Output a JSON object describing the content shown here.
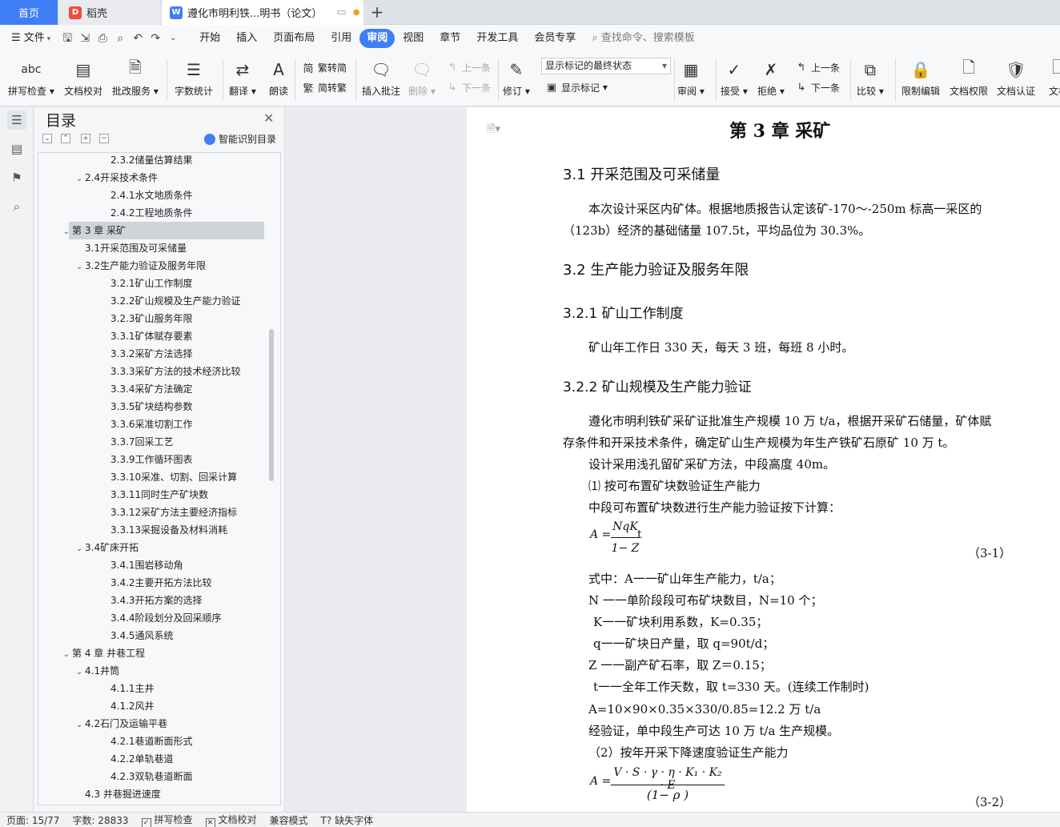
{
  "tabs": {
    "home": "首页",
    "daoke": "稻壳",
    "doc": "遵化市明利铁...明书（论文）",
    "new_tab": "+"
  },
  "menu": {
    "file": "文件",
    "items": [
      "开始",
      "插入",
      "页面布局",
      "引用",
      "审阅",
      "视图",
      "章节",
      "开发工具",
      "会员专享"
    ],
    "active": "审阅",
    "search_placeholder": "查找命令、搜索模板"
  },
  "ribbon": {
    "spell_check": "拼写检查",
    "doc_check": "文档校对",
    "batch_service": "批改服务",
    "word_count": "字数统计",
    "translate": "翻译",
    "read_aloud": "朗读",
    "trad_to_simp": "繁转简",
    "simp_to_trad": "简转繁",
    "insert_comment": "插入批注",
    "delete": "删除",
    "prev_comment": "上一条",
    "next_comment": "下一条",
    "track_changes": "修订",
    "markup_mode": "显示标记的最终状态",
    "show_markup": "显示标记",
    "review": "审阅",
    "accept": "接受",
    "reject": "拒绝",
    "prev_change": "上一条",
    "next_change": "下一条",
    "compare": "比较",
    "restrict_edit": "限制编辑",
    "doc_permission": "文档权限",
    "doc_certify": "文档认证",
    "doc_more": "文档"
  },
  "toc": {
    "title": "目录",
    "smart_recognize": "智能识别目录",
    "items": [
      {
        "level": 3,
        "text": "2.3.2储量估算结果",
        "caret": ""
      },
      {
        "level": 2,
        "text": "2.4开采技术条件",
        "caret": "v"
      },
      {
        "level": 3,
        "text": "2.4.1水文地质条件",
        "caret": ""
      },
      {
        "level": 3,
        "text": "2.4.2工程地质条件",
        "caret": ""
      },
      {
        "level": 1,
        "text": "第 3 章  采矿",
        "caret": "v",
        "selected": true
      },
      {
        "level": 2,
        "text": "3.1开采范围及可采储量",
        "caret": ""
      },
      {
        "level": 2,
        "text": "3.2生产能力验证及服务年限",
        "caret": "v"
      },
      {
        "level": 3,
        "text": "3.2.1矿山工作制度",
        "caret": ""
      },
      {
        "level": 3,
        "text": "3.2.2矿山规模及生产能力验证",
        "caret": ""
      },
      {
        "level": 3,
        "text": "3.2.3矿山服务年限",
        "caret": ""
      },
      {
        "level": 3,
        "text": "3.3.1矿体赋存要素",
        "caret": ""
      },
      {
        "level": 3,
        "text": "3.3.2采矿方法选择",
        "caret": ""
      },
      {
        "level": 3,
        "text": "3.3.3采矿方法的技术经济比较",
        "caret": ""
      },
      {
        "level": 3,
        "text": "3.3.4采矿方法确定",
        "caret": ""
      },
      {
        "level": 3,
        "text": "3.3.5矿块结构参数",
        "caret": ""
      },
      {
        "level": 3,
        "text": "3.3.6采准切割工作",
        "caret": ""
      },
      {
        "level": 3,
        "text": "3.3.7回采工艺",
        "caret": ""
      },
      {
        "level": 3,
        "text": "3.3.9工作循环图表",
        "caret": ""
      },
      {
        "level": 3,
        "text": "3.3.10采准、切割、回采计算",
        "caret": ""
      },
      {
        "level": 3,
        "text": "3.3.11同时生产矿块数",
        "caret": ""
      },
      {
        "level": 3,
        "text": "3.3.12采矿方法主要经济指标",
        "caret": ""
      },
      {
        "level": 3,
        "text": "3.3.13采掘设备及材料消耗",
        "caret": ""
      },
      {
        "level": 2,
        "text": "3.4矿床开拓",
        "caret": "v"
      },
      {
        "level": 3,
        "text": "3.4.1围岩移动角",
        "caret": ""
      },
      {
        "level": 3,
        "text": "3.4.2主要开拓方法比较",
        "caret": ""
      },
      {
        "level": 3,
        "text": "3.4.3开拓方案的选择",
        "caret": ""
      },
      {
        "level": 3,
        "text": "3.4.4阶段划分及回采顺序",
        "caret": ""
      },
      {
        "level": 3,
        "text": "3.4.5通风系统",
        "caret": ""
      },
      {
        "level": 1,
        "text": "第 4 章  井巷工程",
        "caret": "v"
      },
      {
        "level": 2,
        "text": "4.1井筒",
        "caret": "v"
      },
      {
        "level": 3,
        "text": "4.1.1主井",
        "caret": ""
      },
      {
        "level": 3,
        "text": "4.1.2风井",
        "caret": ""
      },
      {
        "level": 2,
        "text": "4.2石门及运输平巷",
        "caret": "v"
      },
      {
        "level": 3,
        "text": "4.2.1巷道断面形式",
        "caret": ""
      },
      {
        "level": 3,
        "text": "4.2.2单轨巷道",
        "caret": ""
      },
      {
        "level": 3,
        "text": "4.2.3双轨巷道断面",
        "caret": ""
      },
      {
        "level": 2,
        "text": "4.3 井巷掘进速度",
        "caret": ""
      }
    ]
  },
  "document": {
    "chapter_title": "第 3 章  采矿",
    "s31_title": "3.1   开采范围及可采储量",
    "s31_p1": "本次设计采区内矿体。根据地质报告认定该矿-170～-250m 标高一采区的",
    "s31_p2": "（123b）经济的基础储量  107.5t，平均品位为  30.3%。",
    "s32_title": "3.2   生产能力验证及服务年限",
    "s321_title": "3.2.1   矿山工作制度",
    "s321_p1": "矿山年工作日  330 天，每天  3 班，每班  8 小时。",
    "s322_title": "3.2.2   矿山规模及生产能力验证",
    "s322_p1": "遵化市明利铁矿采矿证批准生产规模  10 万 t/a，根据开采矿石储量，矿体赋",
    "s322_p2": "存条件和开采技术条件，确定矿山生产规模为年生产铁矿石原矿  10 万 t。",
    "s322_p3": "设计采用浅孔留矿采矿方法，中段高度  40m。",
    "s322_p4": "⑴ 按可布置矿块数验证生产能力",
    "s322_p5": "中段可布置矿块数进行生产能力验证按下计算：",
    "f1_lhs": "A =",
    "f1_num": "NqK",
    "f1_t": "t",
    "f1_den": "1− Z",
    "f1_no": "（3-1）",
    "w1": "式中：A一一矿山年生产能力，t/a；",
    "w2": "N  一一单阶段段可布矿块数目，N=10 个；",
    "w3": "K一一矿块利用系数，K=0.35；",
    "w4": "q一一矿块日产量，取  q=90t/d；",
    "w5": "Z  一一副产矿石率，取  Z＝0.15；",
    "w6": "t一一全年工作天数，取  t=330 天。(连续工作制时)",
    "w7": "A=10×90×0.35×330/0.85=12.2 万   t/a",
    "w8": "经验证，单中段生产可达  10 万   t/a 生产规模。",
    "w9": "（2）按年开采下降速度验证生产能力",
    "f2_lhs": "A =",
    "f2_num": "V · S · γ · η · K₁ · K₂ · E",
    "f2_den": "(1− ρ )",
    "f2_no": "（3-2）"
  },
  "status": {
    "page": "页面: 15/77",
    "words": "字数: 28833",
    "spell": "拼写检查",
    "proof": "文档校对",
    "compat": "兼容模式",
    "missing_font": "缺失字体"
  },
  "colors": {
    "accent": "#3f7ef4"
  }
}
